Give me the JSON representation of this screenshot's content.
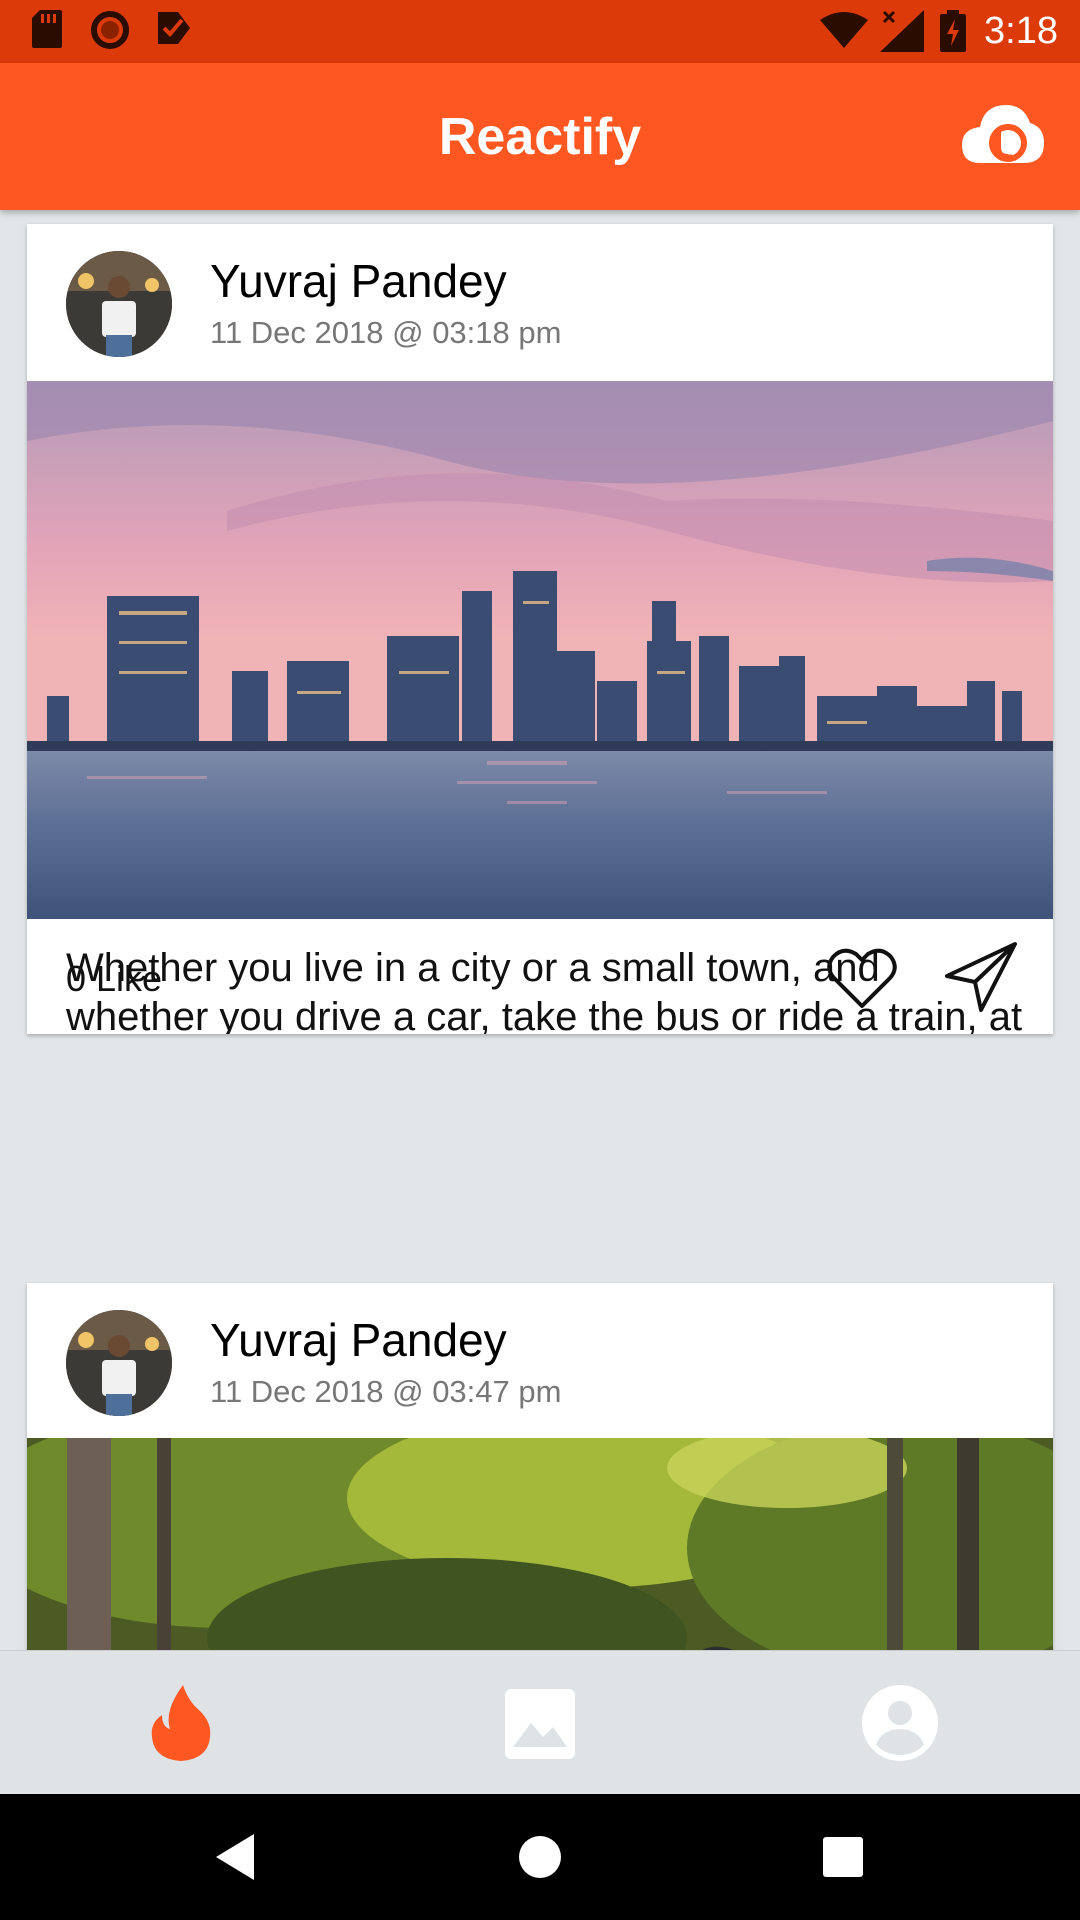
{
  "status_bar": {
    "time": "3:18",
    "left_icons": [
      "sd-card-icon",
      "circle-notification-icon",
      "checklist-notification-icon"
    ],
    "right_icons": [
      "wifi-icon",
      "cell-signal-no-data-icon",
      "battery-charging-icon"
    ],
    "background": "#dd3a0a"
  },
  "app_bar": {
    "title": "Reactify",
    "action_icon": "cloud-upload-icon",
    "background": "#fe5722"
  },
  "posts": [
    {
      "author": "Yuvraj Pandey",
      "timestamp": "11 Dec 2018 @ 03:18 pm",
      "image_subject": "city-skyline-at-dusk",
      "caption": "Whether you live in a city or a small town, and whether you drive a car, take the bus or ride a train, at some point in the day, everyone is a pedestrian.",
      "likes_label": "0 Like",
      "like_icon": "heart-outline-icon",
      "share_icon": "send-icon"
    },
    {
      "author": "Yuvraj Pandey",
      "timestamp": "11 Dec 2018 @ 03:47 pm",
      "image_subject": "forest-road"
    }
  ],
  "bottom_nav": {
    "items": [
      {
        "icon": "flame-icon",
        "active": true
      },
      {
        "icon": "image-icon",
        "active": false
      },
      {
        "icon": "account-circle-icon",
        "active": false
      }
    ],
    "active_color": "#fe5722",
    "inactive_color": "#ffffff"
  },
  "system_nav": {
    "buttons": [
      "back-icon",
      "home-icon",
      "recents-icon"
    ]
  }
}
